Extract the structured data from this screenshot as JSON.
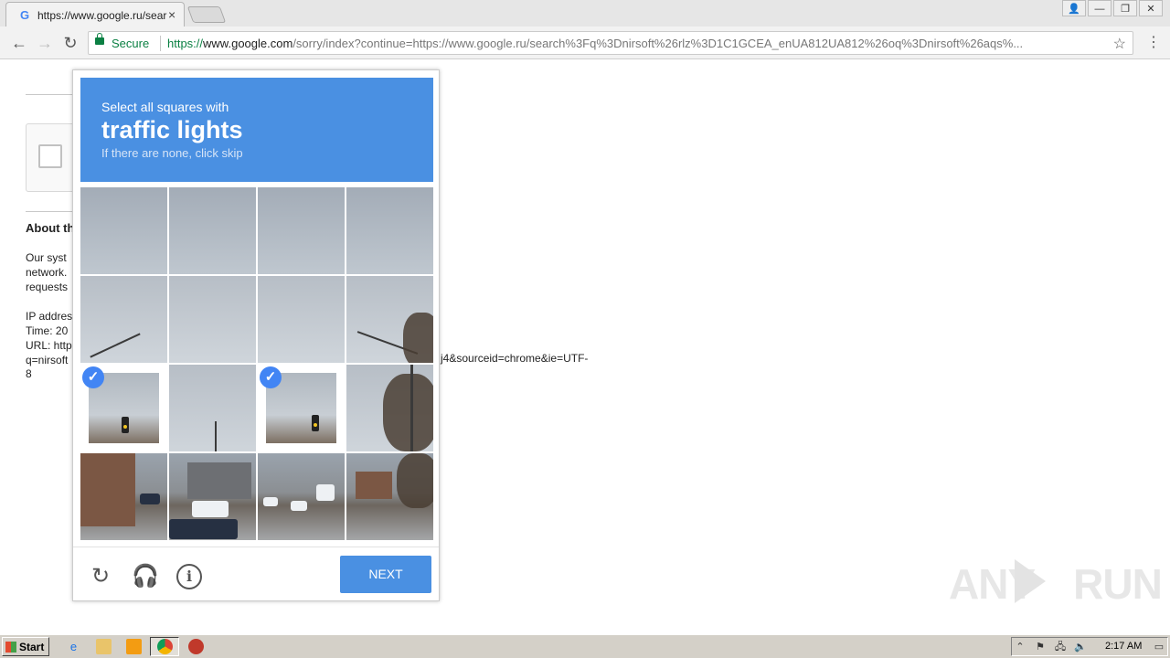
{
  "browser": {
    "tab_title": "https://www.google.ru/sear",
    "tab_close": "×",
    "favicon": "G",
    "window_controls": [
      "👤",
      "—",
      "❐",
      "✕"
    ],
    "nav": {
      "back": "←",
      "forward": "→",
      "reload": "↻"
    },
    "secure_label": "Secure",
    "url_scheme": "https://",
    "url_host": "www.google.com",
    "url_path": "/sorry/index?continue=https://www.google.ru/search%3Fq%3Dnirsoft%26rlz%3D1C1GCEA_enUA812UA812%26oq%3Dnirsoft%26aqs%...",
    "star": "☆",
    "menu": "⋮"
  },
  "page": {
    "about_heading": "About th",
    "para1": "Our syst\nnetwork.\nrequests",
    "para2": "IP addres\nTime: 20\nURL: http\nq=nirsoft",
    "url_tail": "j4&sourceid=chrome&ie=UTF-",
    "url_tail_end": "8"
  },
  "captcha": {
    "line1": "Select all squares with",
    "line2": "traffic lights",
    "line3": "If there are none, click skip",
    "check_mark": "✓",
    "reload_icon": "↻",
    "audio_icon": "🎧",
    "info_icon": "i",
    "next_label": "NEXT",
    "header_color": "#4a90e2"
  },
  "watermark": {
    "left": "ANY",
    "right": "RUN"
  },
  "taskbar": {
    "start_label": "Start",
    "clock": "2:17 AM",
    "tray_icons": [
      "⌃",
      "⚑",
      "🖧",
      "🔈",
      "▭"
    ]
  }
}
